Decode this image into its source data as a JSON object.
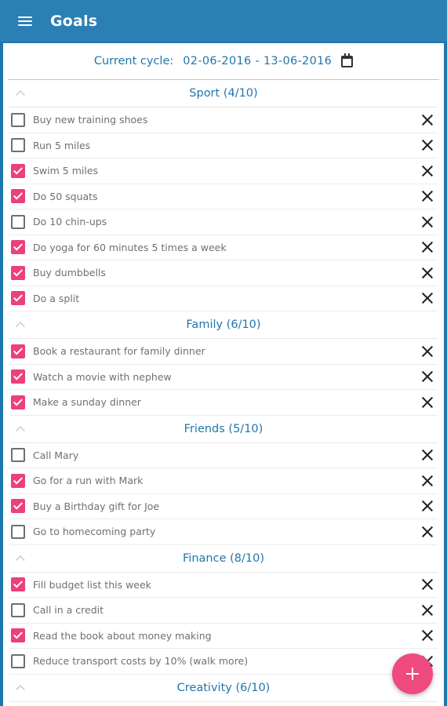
{
  "app": {
    "title": "Goals"
  },
  "cycle": {
    "label": "Current cycle:",
    "value": "02-06-2016 - 13-06-2016"
  },
  "sections": [
    {
      "title": "Sport (4/10)",
      "items": [
        {
          "text": "Buy new training shoes",
          "checked": false
        },
        {
          "text": "Run 5 miles",
          "checked": false
        },
        {
          "text": "Swim 5 miles",
          "checked": true
        },
        {
          "text": "Do 50 squats",
          "checked": true
        },
        {
          "text": "Do 10 chin-ups",
          "checked": false
        },
        {
          "text": "Do yoga for 60 minutes 5 times a week",
          "checked": true
        },
        {
          "text": "Buy dumbbells",
          "checked": true
        },
        {
          "text": "Do a split",
          "checked": true
        }
      ]
    },
    {
      "title": "Family (6/10)",
      "items": [
        {
          "text": "Book a restaurant for family dinner",
          "checked": true
        },
        {
          "text": "Watch a movie with nephew",
          "checked": true
        },
        {
          "text": "Make a sunday dinner",
          "checked": true
        }
      ]
    },
    {
      "title": "Friends (5/10)",
      "items": [
        {
          "text": "Call Mary",
          "checked": false
        },
        {
          "text": "Go for a run with Mark",
          "checked": true
        },
        {
          "text": "Buy a Birthday gift for Joe",
          "checked": true
        },
        {
          "text": "Go to homecoming party",
          "checked": false
        }
      ]
    },
    {
      "title": "Finance (8/10)",
      "items": [
        {
          "text": "Fill budget list this week",
          "checked": true
        },
        {
          "text": "Call in a credit",
          "checked": false
        },
        {
          "text": "Read the book about money making",
          "checked": true
        },
        {
          "text": "Reduce transport costs by 10% (walk more)",
          "checked": false
        }
      ]
    },
    {
      "title": "Creativity (6/10)",
      "items": []
    }
  ],
  "colors": {
    "appbar": "#2a80b4",
    "accent": "#ec407a",
    "section_title": "#2076ae"
  },
  "icons": {
    "menu": "menu-icon",
    "calendar": "calendar-icon",
    "collapse": "chevron-up-icon",
    "remove": "close-icon",
    "add": "plus-icon"
  }
}
